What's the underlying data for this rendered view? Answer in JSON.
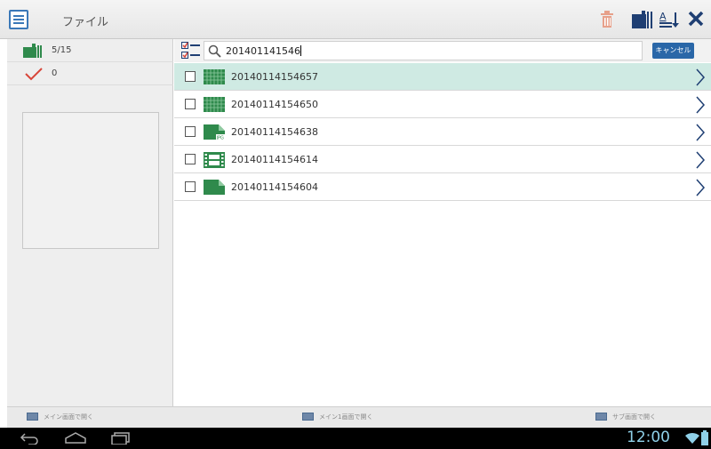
{
  "header": {
    "title": "ファイル"
  },
  "left_panel": {
    "count": "5/15",
    "checked": "0"
  },
  "search": {
    "query": "201401141546",
    "cancel_label": "キャンセル"
  },
  "files": [
    {
      "name": "20140114154657",
      "type": "image",
      "selected": true
    },
    {
      "name": "20140114154650",
      "type": "image",
      "selected": false
    },
    {
      "name": "20140114154638",
      "type": "jpeg",
      "selected": false
    },
    {
      "name": "20140114154614",
      "type": "video",
      "selected": false
    },
    {
      "name": "20140114154604",
      "type": "document",
      "selected": false
    }
  ],
  "bottom_bar": {
    "open_main": "メイン画面で開く",
    "open_main1": "メイン1画面で開く",
    "open_sub": "サブ画面で開く"
  },
  "system": {
    "clock": "12:00"
  },
  "colors": {
    "accent": "#2a67a8",
    "selected_row": "#cfeae3",
    "file_green": "#2f8a4c",
    "trash": "#e7a08a"
  }
}
